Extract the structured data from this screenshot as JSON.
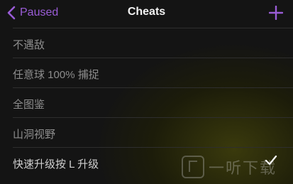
{
  "navbar": {
    "back_label": "Paused",
    "title": "Cheats",
    "add_icon": "plus-icon",
    "accent_color": "#9a5cd6"
  },
  "cheats": [
    {
      "label": "不遇敌",
      "enabled": false
    },
    {
      "label": "任意球 100% 捕捉",
      "enabled": false
    },
    {
      "label": "全图鉴",
      "enabled": false
    },
    {
      "label": "山洞视野",
      "enabled": false
    },
    {
      "label": "快速升级按 L 升级",
      "enabled": true
    }
  ],
  "watermark": {
    "text": "一听下载"
  }
}
